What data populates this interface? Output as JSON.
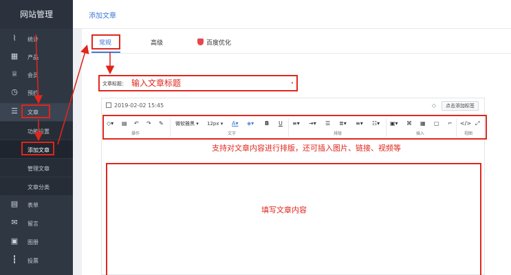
{
  "sidebar": {
    "title": "网站管理",
    "items": [
      {
        "label": "统计",
        "icon": "chart-line-icon",
        "glyph": "⌇"
      },
      {
        "label": "产品",
        "icon": "grid-icon",
        "glyph": "▦"
      },
      {
        "label": "会员",
        "icon": "crown-icon",
        "glyph": "♕"
      },
      {
        "label": "预约",
        "icon": "clock-icon",
        "glyph": "◷"
      },
      {
        "label": "文章",
        "icon": "article-icon",
        "glyph": "☰"
      }
    ],
    "sub_items": [
      {
        "label": "功能设置"
      },
      {
        "label": "添加文章"
      },
      {
        "label": "管理文章"
      },
      {
        "label": "文章分类"
      }
    ],
    "items_bottom": [
      {
        "label": "表单",
        "icon": "form-icon",
        "glyph": "▤"
      },
      {
        "label": "留言",
        "icon": "message-icon",
        "glyph": "✉"
      },
      {
        "label": "图册",
        "icon": "image-icon",
        "glyph": "▣"
      },
      {
        "label": "投票",
        "icon": "bar-chart-icon",
        "glyph": "┇"
      }
    ]
  },
  "header": {
    "title": "添加文章"
  },
  "tabs": [
    {
      "label": "常规"
    },
    {
      "label": "高级"
    },
    {
      "label": "百度优化"
    }
  ],
  "form": {
    "title_label": "文章标题：",
    "title_placeholder": "输入文章标题",
    "required_mark": "•"
  },
  "editor": {
    "date": "2019-02-02 15:45",
    "add_tag_label": "点击添加标签",
    "toolbar": {
      "font_family": "微软雅黑",
      "font_size": "12px",
      "groups": [
        "操作",
        "文字",
        "排版",
        "插入",
        "视图"
      ]
    },
    "toolbar_hint": "支持对文章内容进行排版，还可插入图片、链接、视频等",
    "body_placeholder": "填写文章内容"
  },
  "colors": {
    "accent": "#3d7ad6",
    "annotation": "#e0261b",
    "sidebar_bg": "#2f3743"
  }
}
